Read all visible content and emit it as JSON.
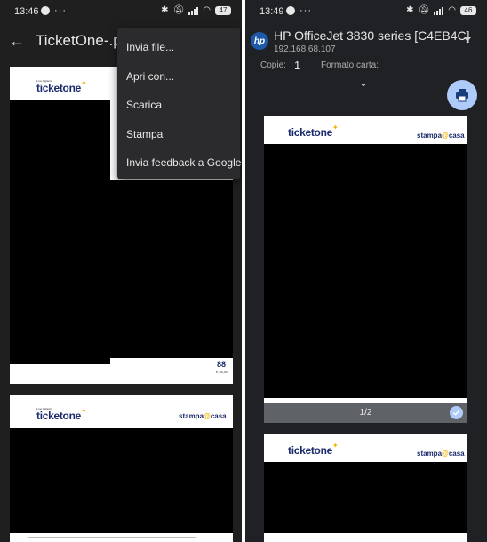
{
  "left": {
    "status": {
      "time": "13:46",
      "battery": "47"
    },
    "title": "TicketOne-.pdf",
    "menu": [
      "Invia file...",
      "Apri con...",
      "Scarica",
      "Stampa",
      "Invia feedback a Google"
    ],
    "page1": {
      "brand": "ticketone",
      "tagline": "il tuo biglietto",
      "seat_number": "88",
      "price": "€ 46,00"
    },
    "page2": {
      "brand": "ticketone",
      "tagline": "il tuo biglietto",
      "print_brand_left": "stampa",
      "print_brand_right": "casa"
    }
  },
  "right": {
    "status": {
      "time": "13:49",
      "battery": "46"
    },
    "printer_name": "HP OfficeJet 3830 series [C4EB4C]",
    "printer_ip": "192.168.68.107",
    "copies_label": "Copie:",
    "copies_value": "1",
    "format_label": "Formato carta:",
    "page_indicator": "1/2",
    "page1": {
      "brand": "ticketone",
      "print_brand_left": "stampa",
      "print_brand_right": "casa"
    },
    "page2": {
      "brand": "ticketone",
      "print_brand_left": "stampa",
      "print_brand_right": "casa"
    }
  },
  "icons": {
    "back": "arrow-left-icon",
    "hp": "hp-logo-icon",
    "dropdown": "chevron-down-icon",
    "print_fab": "printer-icon",
    "selected": "check-icon"
  }
}
